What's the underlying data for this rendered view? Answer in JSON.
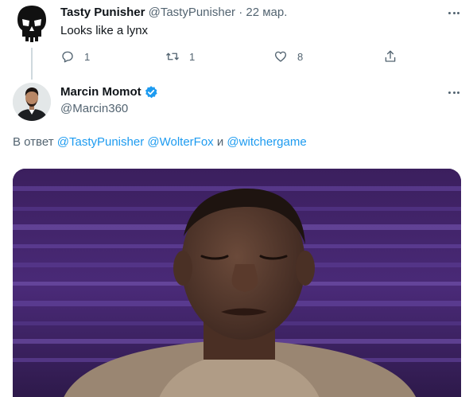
{
  "reply": {
    "author_name": "Tasty Punisher",
    "handle": "@TastyPunisher",
    "separator": "·",
    "date": "22 мар.",
    "text": "Looks like a lynx",
    "counts": {
      "replies": "1",
      "retweets": "1",
      "likes": "8"
    }
  },
  "main": {
    "author_name": "Marcin Momot",
    "handle": "@Marcin360",
    "reply_prefix": "В ответ",
    "mentions": [
      "@TastyPunisher",
      "@WolterFox"
    ],
    "conjunction": "и",
    "last_mention": "@witchergame"
  },
  "icons": {
    "reply": "comment-bubble-icon",
    "retweet": "retweet-icon",
    "like": "heart-icon",
    "share": "share-icon",
    "more": "more-dots-icon",
    "verified": "verified-badge-icon"
  },
  "colors": {
    "link": "#1d9bf0",
    "muted": "#536471",
    "text": "#0f1419",
    "verified": "#1d9bf0"
  }
}
